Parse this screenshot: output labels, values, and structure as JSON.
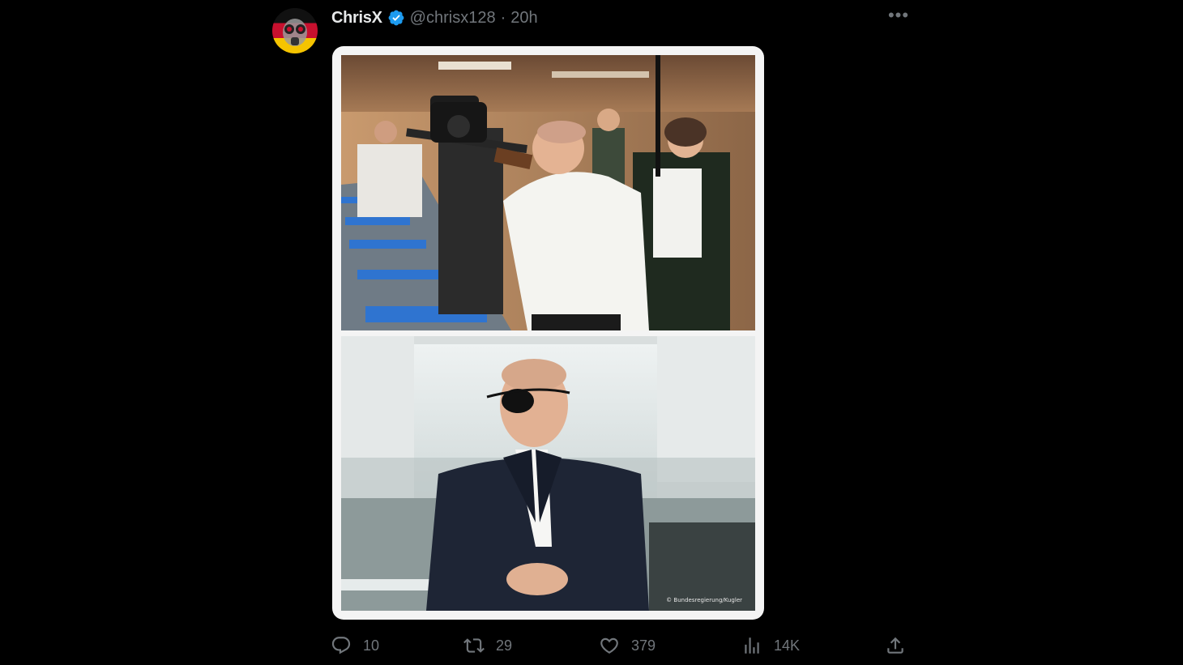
{
  "tweet": {
    "author": {
      "display_name": "ChrisX",
      "handle": "@chrisx128",
      "verified": true,
      "avatar_icon": "avatar-germany-flag-gas-mask"
    },
    "separator": "·",
    "time": "20h",
    "more_icon": "ellipsis-icon",
    "media": {
      "photo_credit": "© Bundesregierung/Kugler"
    },
    "metrics": {
      "replies": "10",
      "retweets": "29",
      "likes": "379",
      "views": "14K"
    }
  },
  "colors": {
    "background": "#000000",
    "text_primary": "#e7e9ea",
    "text_secondary": "#71767b",
    "verified_badge": "#1d9bf0"
  }
}
